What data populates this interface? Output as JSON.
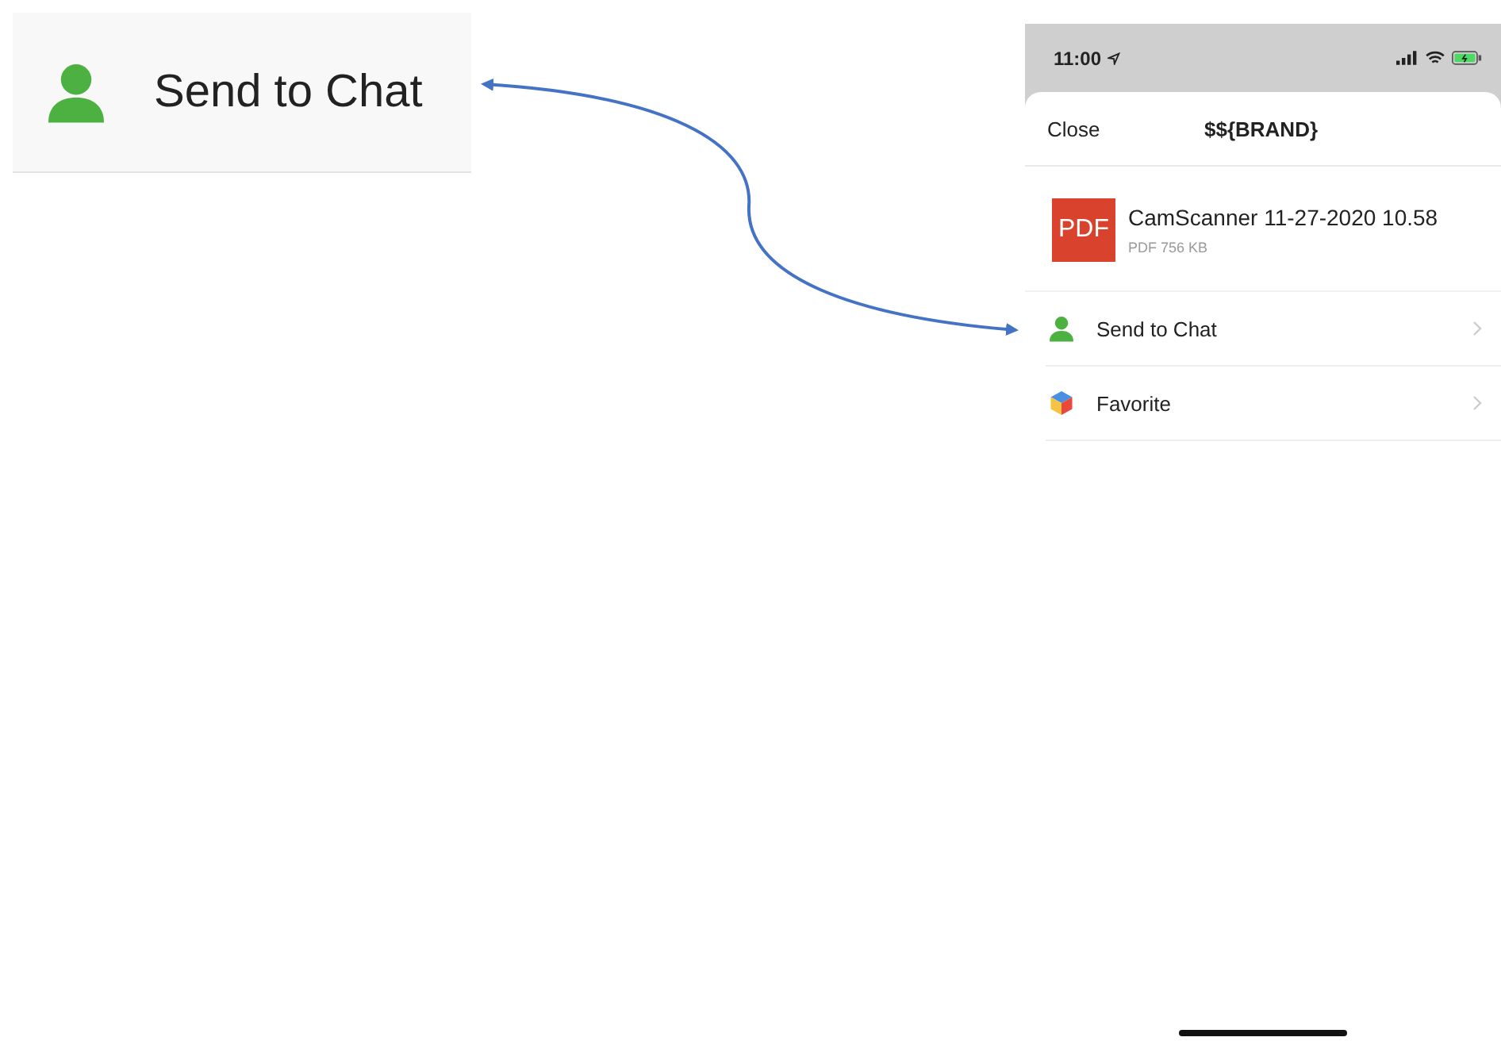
{
  "callout": {
    "kind": "person",
    "label": "Send to Chat"
  },
  "phone": {
    "status_bar": {
      "time": "11:00"
    },
    "sheet": {
      "close": "Close",
      "title": "$${BRAND}",
      "file": {
        "badge": "PDF",
        "name": "CamScanner 11-27-2020 10.58",
        "meta": "PDF 756 KB"
      },
      "actions": [
        {
          "kind": "person",
          "label": "Send to Chat"
        },
        {
          "kind": "cube",
          "label": "Favorite"
        }
      ]
    }
  }
}
